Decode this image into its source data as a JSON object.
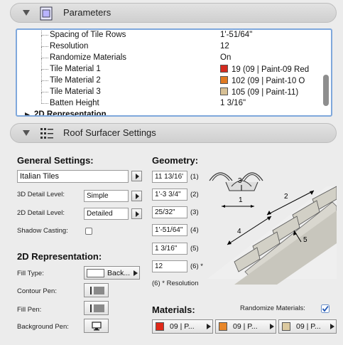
{
  "parameters_section": {
    "title": "Parameters",
    "rows": [
      {
        "name": "Spacing of Tile Rows",
        "value": "1'-51/64\""
      },
      {
        "name": "Resolution",
        "value": "12"
      },
      {
        "name": "Randomize Materials",
        "value": "On"
      },
      {
        "name": "Tile Material 1",
        "value": "19 (09 | Paint-09 Red",
        "swatch": "#d42a1f"
      },
      {
        "name": "Tile Material 2",
        "value": "102 (09 | Paint-10 O",
        "swatch": "#e07a22"
      },
      {
        "name": "Tile Material 3",
        "value": "105 (09 | Paint-11)",
        "swatch": "#d7c095"
      },
      {
        "name": "Batten Height",
        "value": "1 3/16\""
      }
    ],
    "group_row": "2D Representation"
  },
  "roof_section": {
    "title": "Roof Surfacer Settings"
  },
  "general": {
    "heading": "General Settings:",
    "preset_value": "Italian Tiles",
    "detail3d_label": "3D Detail Level:",
    "detail3d_value": "Simple",
    "detail2d_label": "2D Detail Level:",
    "detail2d_value": "Detailed",
    "shadow_label": "Shadow Casting:"
  },
  "rep2d": {
    "heading": "2D Representation:",
    "fill_type_label": "Fill Type:",
    "fill_type_value": "Back...",
    "contour_pen_label": "Contour Pen:",
    "fill_pen_label": "Fill Pen:",
    "background_pen_label": "Background Pen:"
  },
  "geometry": {
    "heading": "Geometry:",
    "fields": [
      {
        "value": "11 13/16'",
        "tag": "(1)"
      },
      {
        "value": "1'-3 3/4\"",
        "tag": "(2)"
      },
      {
        "value": "25/32\"",
        "tag": "(3)"
      },
      {
        "value": "1'-51/64\"",
        "tag": "(4)"
      },
      {
        "value": "1 3/16\"",
        "tag": "(5)"
      },
      {
        "value": "12",
        "tag": "(6) *"
      }
    ],
    "note": "(6) * Resolution",
    "diagram_labels": [
      "1",
      "2",
      "3",
      "4",
      "5"
    ]
  },
  "materials": {
    "heading": "Materials:",
    "randomize_label": "Randomize Materials:",
    "randomize_checked": true,
    "items": [
      {
        "label": "09 | P...",
        "color": "#e02818"
      },
      {
        "label": "09 | P...",
        "color": "#e8872a"
      },
      {
        "label": "09 | P...",
        "color": "#dccaa0"
      }
    ]
  }
}
